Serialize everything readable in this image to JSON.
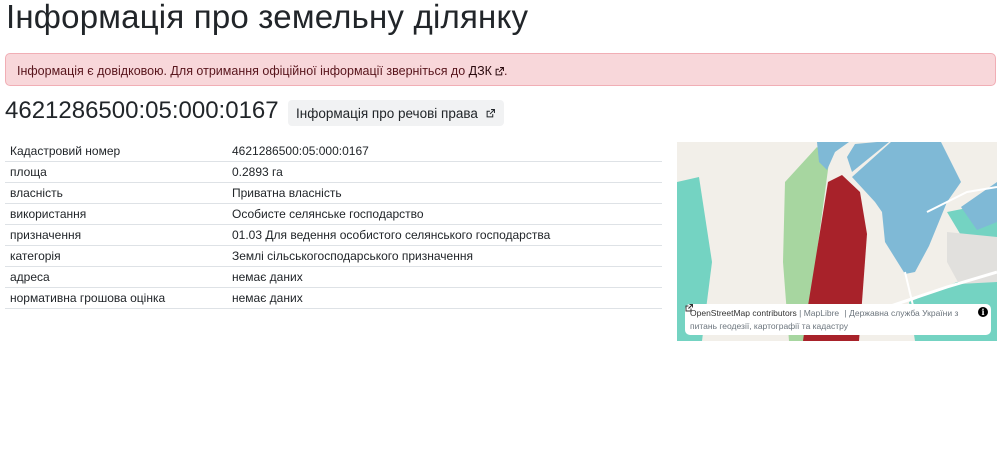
{
  "page": {
    "title": "Інформація про земельну ділянку"
  },
  "alert": {
    "text": "Інформація є довідковою. Для отримання офіційної інформації зверніться до ",
    "link_label": "ДЗК",
    "suffix": ".",
    "link_icon": "external-link-icon"
  },
  "parcel": {
    "cadastral_number": "4621286500:05:000:0167",
    "rights_button_label": "Інформація про речові права",
    "rights_button_icon": "external-link-icon"
  },
  "info_table": {
    "rows": [
      {
        "key": "Кадастровий номер",
        "value": "4621286500:05:000:0167"
      },
      {
        "key": "площа",
        "value": "0.2893 га"
      },
      {
        "key": "власність",
        "value": "Приватна власність"
      },
      {
        "key": "використання",
        "value": "Особисте селянське господарство"
      },
      {
        "key": "призначення",
        "value": "01.03 Для ведення особистого селянського господарства"
      },
      {
        "key": "категорія",
        "value": "Землі сільськогосподарського призначення"
      },
      {
        "key": "адреса",
        "value": "немає даних"
      },
      {
        "key": "нормативна грошова оцінка",
        "value": "немає даних"
      }
    ]
  },
  "map": {
    "attribution": {
      "osm": "OpenStreetMap contributors",
      "sep1": " | ",
      "maplibre": "MapLibre",
      "sep2": " | ",
      "agency": "Державна служба України з питань геодезії, картографії та кадастру",
      "info_icon": "info-icon",
      "link_icon": "external-link-icon"
    },
    "colors": {
      "background": "#f2efe9",
      "parcel": "#a8222a",
      "buildings": "#7fb9d6",
      "grass": "#a7d6a0",
      "teal": "#74d3c2",
      "roads": "#ffffff"
    }
  }
}
